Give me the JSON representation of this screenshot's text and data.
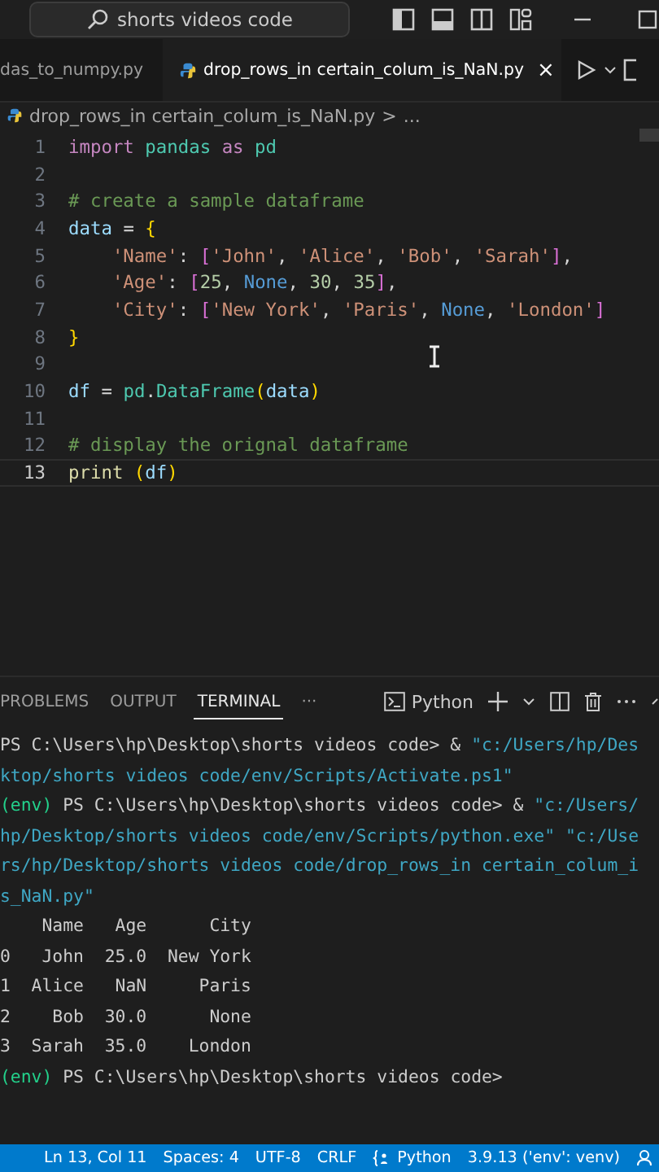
{
  "title_bar": {
    "search": "shorts videos code"
  },
  "tabs": [
    {
      "label": "das_to_numpy.py",
      "selected": false
    },
    {
      "label": "drop_rows_in certain_colum_is_NaN.py",
      "selected": true,
      "close": "×"
    }
  ],
  "breadcrumb": {
    "file": "drop_rows_in certain_colum_is_NaN.py",
    "separator": ">",
    "more": "..."
  },
  "code_lines": [
    {
      "number": "1",
      "current": false,
      "tokens": [
        {
          "kind": "keyword",
          "text": "import "
        },
        {
          "kind": "type",
          "text": "pandas "
        },
        {
          "kind": "keyword",
          "text": "as "
        },
        {
          "kind": "type",
          "text": "pd"
        }
      ]
    },
    {
      "number": "2",
      "current": false
    },
    {
      "number": "3",
      "current": false,
      "tokens": [
        {
          "kind": "comment",
          "text": "# create a sample dataframe"
        }
      ]
    },
    {
      "number": "4",
      "current": false,
      "tokens": [
        {
          "kind": "variable",
          "text": "data "
        },
        {
          "kind": "plain",
          "text": "= "
        },
        {
          "kind": "bracket1",
          "text": "{"
        }
      ]
    },
    {
      "number": "5",
      "current": false,
      "tokens": [
        {
          "kind": "string",
          "text": "    'Name'"
        },
        {
          "kind": "plain",
          "text": ": "
        },
        {
          "kind": "bracket2",
          "text": "["
        },
        {
          "kind": "string",
          "text": "'John'"
        },
        {
          "kind": "plain",
          "text": ", "
        },
        {
          "kind": "string",
          "text": "'Alice'"
        },
        {
          "kind": "plain",
          "text": ", "
        },
        {
          "kind": "string",
          "text": "'Bob'"
        },
        {
          "kind": "plain",
          "text": ", "
        },
        {
          "kind": "string",
          "text": "'Sarah'"
        },
        {
          "kind": "bracket2",
          "text": "]"
        },
        {
          "kind": "plain",
          "text": ","
        }
      ]
    },
    {
      "number": "6",
      "current": false,
      "tokens": [
        {
          "kind": "string",
          "text": "    'Age'"
        },
        {
          "kind": "plain",
          "text": ": "
        },
        {
          "kind": "bracket2",
          "text": "["
        },
        {
          "kind": "number",
          "text": "25"
        },
        {
          "kind": "plain",
          "text": ", "
        },
        {
          "kind": "constant",
          "text": "None"
        },
        {
          "kind": "plain",
          "text": ", "
        },
        {
          "kind": "number",
          "text": "30"
        },
        {
          "kind": "plain",
          "text": ", "
        },
        {
          "kind": "number",
          "text": "35"
        },
        {
          "kind": "bracket2",
          "text": "]"
        },
        {
          "kind": "plain",
          "text": ","
        }
      ]
    },
    {
      "number": "7",
      "current": false,
      "tokens": [
        {
          "kind": "string",
          "text": "    'City'"
        },
        {
          "kind": "plain",
          "text": ": "
        },
        {
          "kind": "bracket2",
          "text": "["
        },
        {
          "kind": "string",
          "text": "'New York'"
        },
        {
          "kind": "plain",
          "text": ", "
        },
        {
          "kind": "string",
          "text": "'Paris'"
        },
        {
          "kind": "plain",
          "text": ", "
        },
        {
          "kind": "constant",
          "text": "None"
        },
        {
          "kind": "plain",
          "text": ", "
        },
        {
          "kind": "string",
          "text": "'London'"
        },
        {
          "kind": "bracket2",
          "text": "]"
        }
      ]
    },
    {
      "number": "8",
      "current": false,
      "tokens": [
        {
          "kind": "bracket1",
          "text": "}"
        }
      ]
    },
    {
      "number": "9",
      "current": false
    },
    {
      "number": "10",
      "current": false,
      "tokens": [
        {
          "kind": "variable",
          "text": "df "
        },
        {
          "kind": "plain",
          "text": "= "
        },
        {
          "kind": "type",
          "text": "pd"
        },
        {
          "kind": "plain",
          "text": "."
        },
        {
          "kind": "type",
          "text": "DataFrame"
        },
        {
          "kind": "bracket1",
          "text": "("
        },
        {
          "kind": "variable",
          "text": "data"
        },
        {
          "kind": "bracket1",
          "text": ")"
        }
      ]
    },
    {
      "number": "11",
      "current": false
    },
    {
      "number": "12",
      "current": false,
      "tokens": [
        {
          "kind": "comment",
          "text": "# display the orignal dataframe"
        }
      ]
    },
    {
      "number": "13",
      "current": true,
      "tokens": [
        {
          "kind": "function",
          "text": "print "
        },
        {
          "kind": "bracket1",
          "text": "("
        },
        {
          "kind": "variable",
          "text": "df"
        },
        {
          "kind": "bracket1",
          "text": ")"
        }
      ]
    }
  ],
  "panel_tabs": [
    {
      "label": "PROBLEMS",
      "selected": false
    },
    {
      "label": "OUTPUT",
      "selected": false
    },
    {
      "label": "TERMINAL",
      "selected": true
    }
  ],
  "panel_more": "···",
  "terminal_name": "Python",
  "terminal_lines": [
    [
      {
        "kind": "plain",
        "text": "PS C:\\Users\\hp\\Desktop\\shorts videos code> & "
      },
      {
        "kind": "string",
        "text": "\"c:/Users/hp/Des"
      }
    ],
    [
      {
        "kind": "string",
        "text": "ktop/shorts videos code/env/Scripts/Activate.ps1\""
      }
    ],
    [
      {
        "kind": "env",
        "text": "(env)"
      },
      {
        "kind": "plain",
        "text": " PS C:\\Users\\hp\\Desktop\\shorts videos code> & "
      },
      {
        "kind": "string",
        "text": "\"c:/Users/"
      }
    ],
    [
      {
        "kind": "string",
        "text": "hp/Desktop/shorts videos code/env/Scripts/python.exe\" \"c:/Use"
      }
    ],
    [
      {
        "kind": "string",
        "text": "rs/hp/Desktop/shorts videos code/drop_rows_in certain_colum_i"
      }
    ],
    [
      {
        "kind": "string",
        "text": "s_NaN.py\""
      }
    ],
    [
      {
        "kind": "plain",
        "text": "    Name   Age      City"
      }
    ],
    [
      {
        "kind": "plain",
        "text": "0   John  25.0  New York"
      }
    ],
    [
      {
        "kind": "plain",
        "text": "1  Alice   NaN     Paris"
      }
    ],
    [
      {
        "kind": "plain",
        "text": "2    Bob  30.0      None"
      }
    ],
    [
      {
        "kind": "plain",
        "text": "3  Sarah  35.0    London"
      }
    ],
    [
      {
        "kind": "env",
        "text": "(env)"
      },
      {
        "kind": "plain",
        "text": " PS C:\\Users\\hp\\Desktop\\shorts videos code>"
      }
    ]
  ],
  "status_bar": [
    "Ln 13, Col 11",
    "Spaces: 4",
    "UTF-8",
    "CRLF",
    "Python",
    "3.9.13 ('env': venv)"
  ]
}
